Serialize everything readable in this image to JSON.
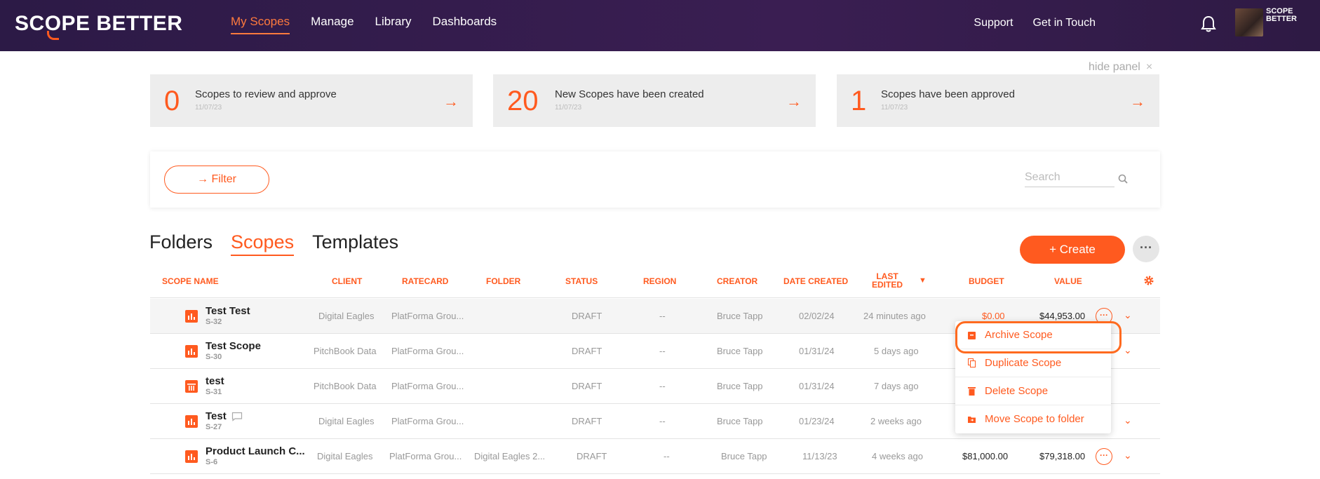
{
  "brand": {
    "logo_text_1": "SC",
    "logo_o": "O",
    "logo_text_2": "PE BETTER",
    "mini_logo": "SCOPE BETTER"
  },
  "nav": [
    "My Scopes",
    "Manage",
    "Library",
    "Dashboards"
  ],
  "right_nav": {
    "support": "Support",
    "contact": "Get in Touch"
  },
  "panel": {
    "hide_label": "hide panel",
    "close": "×"
  },
  "cards": [
    {
      "count": "0",
      "title": "Scopes to review and approve",
      "date": "11/07/23"
    },
    {
      "count": "20",
      "title": "New Scopes have been created",
      "date": "11/07/23"
    },
    {
      "count": "1",
      "title": "Scopes have been approved",
      "date": "11/07/23"
    }
  ],
  "filter": {
    "label": "→ Filter",
    "search_placeholder": "Search"
  },
  "tabs": [
    "Folders",
    "Scopes",
    "Templates"
  ],
  "actions": {
    "create": "+ Create",
    "more": "···"
  },
  "columns": {
    "scope_name": "SCOPE NAME",
    "client": "CLIENT",
    "ratecard": "RATECARD",
    "folder": "FOLDER",
    "status": "STATUS",
    "region": "REGION",
    "creator": "CREATOR",
    "date_created": "DATE CREATED",
    "last_edited_1": "LAST",
    "last_edited_2": "EDITED",
    "sort_arrow": "▼",
    "budget": "BUDGET",
    "value": "VALUE"
  },
  "rows": [
    {
      "name": "Test Test",
      "id": "S-32",
      "client": "Digital Eagles",
      "ratecard": "PlatForma Grou...",
      "folder": "",
      "status": "DRAFT",
      "region": "--",
      "creator": "Bruce Tapp",
      "date_created": "02/02/24",
      "last_edited": "24 minutes ago",
      "budget": "$0.00",
      "value": "$44,953.00"
    },
    {
      "name": "Test Scope",
      "id": "S-30",
      "client": "PitchBook Data",
      "ratecard": "PlatForma Grou...",
      "folder": "",
      "status": "DRAFT",
      "region": "--",
      "creator": "Bruce Tapp",
      "date_created": "01/31/24",
      "last_edited": "5 days ago",
      "budget": "",
      "value": ""
    },
    {
      "name": "test",
      "id": "S-31",
      "client": "PitchBook Data",
      "ratecard": "PlatForma Grou...",
      "folder": "",
      "status": "DRAFT",
      "region": "--",
      "creator": "Bruce Tapp",
      "date_created": "01/31/24",
      "last_edited": "7 days ago",
      "budget": "",
      "value": ""
    },
    {
      "name": "Test",
      "id": "S-27",
      "client": "Digital Eagles",
      "ratecard": "PlatForma Grou...",
      "folder": "",
      "status": "DRAFT",
      "region": "--",
      "creator": "Bruce Tapp",
      "date_created": "01/23/24",
      "last_edited": "2 weeks ago",
      "budget": "",
      "value": ""
    },
    {
      "name": "Product Launch C...",
      "id": "S-6",
      "client": "Digital Eagles",
      "ratecard": "PlatForma Grou...",
      "folder": "Digital Eagles 2...",
      "status": "DRAFT",
      "region": "--",
      "creator": "Bruce Tapp",
      "date_created": "11/13/23",
      "last_edited": "4 weeks ago",
      "budget": "$81,000.00",
      "value": "$79,318.00"
    }
  ],
  "row_icons": [
    "chart-icon",
    "chart-icon",
    "table-icon",
    "chart-icon",
    "chart-icon"
  ],
  "context_menu": [
    "Archive Scope",
    "Duplicate Scope",
    "Delete Scope",
    "Move Scope to folder"
  ],
  "colors": {
    "accent": "#ff5a1f",
    "topbar": "#2c1a46",
    "card_bg": "#ededed",
    "selected_row": "#f5f5f5"
  }
}
